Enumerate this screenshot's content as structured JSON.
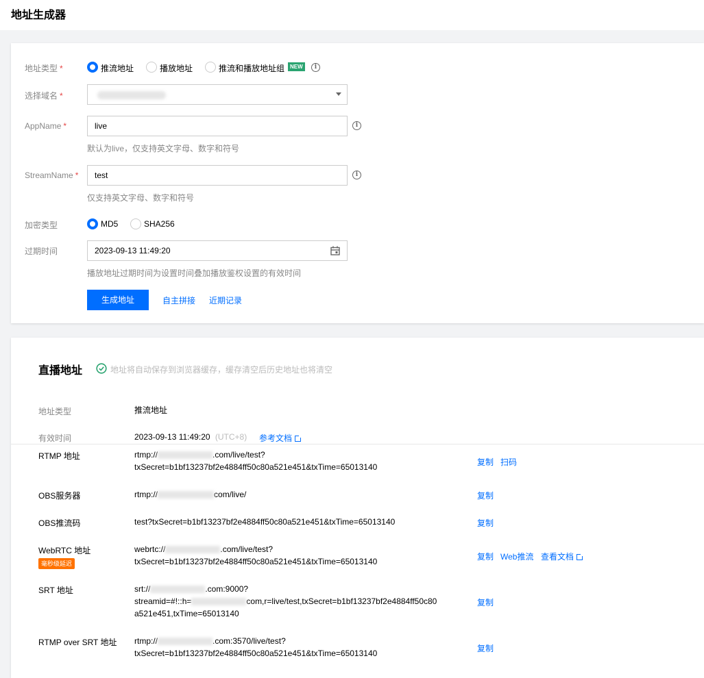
{
  "page_title": "地址生成器",
  "form": {
    "address_type": {
      "label": "地址类型",
      "required": "*",
      "options": [
        {
          "label": "推流地址",
          "selected": true
        },
        {
          "label": "播放地址",
          "selected": false
        },
        {
          "label": "推流和播放地址组",
          "selected": false
        }
      ],
      "new_badge": "NEW"
    },
    "domain": {
      "label": "选择域名",
      "required": "*"
    },
    "app_name": {
      "label": "AppName",
      "required": "*",
      "value": "live",
      "hint": "默认为live，仅支持英文字母、数字和符号"
    },
    "stream_name": {
      "label": "StreamName",
      "required": "*",
      "value": "test",
      "hint": "仅支持英文字母、数字和符号"
    },
    "encrypt_type": {
      "label": "加密类型",
      "options": [
        {
          "label": "MD5",
          "selected": true
        },
        {
          "label": "SHA256",
          "selected": false
        }
      ]
    },
    "expire_time": {
      "label": "过期时间",
      "value": "2023-09-13 11:49:20",
      "hint": "播放地址过期时间为设置时间叠加播放鉴权设置的有效时间"
    },
    "generate_button": "生成地址",
    "custom_link": "自主拼接",
    "recent_link": "近期记录"
  },
  "result": {
    "title": "直播地址",
    "notice": "地址将自动保存到浏览器缓存，缓存清空后历史地址也将清空",
    "type_label": "地址类型",
    "type_value": "推流地址",
    "valid_label": "有效时间",
    "valid_value": "2023-09-13 11:49:20",
    "valid_tz": "(UTC+8)",
    "doc_link": "参考文档",
    "rows": [
      {
        "label": "RTMP 地址",
        "line1_pre": "rtmp://",
        "line1_post": ".com/live/test?",
        "line2": "txSecret=b1bf13237bf2e4884ff50c80a521e451&txTime=65013140",
        "copy": "复制",
        "extra": "扫码"
      },
      {
        "label": "OBS服务器",
        "line1_pre": "rtmp://",
        "line1_post": "com/live/",
        "copy": "复制"
      },
      {
        "label": "OBS推流码",
        "line1": "test?txSecret=b1bf13237bf2e4884ff50c80a521e451&txTime=65013140",
        "copy": "复制"
      },
      {
        "label": "WebRTC 地址",
        "badge": "毫秒级延迟",
        "line1_pre": "webrtc://",
        "line1_post": ".com/live/test?",
        "line2": "txSecret=b1bf13237bf2e4884ff50c80a521e451&txTime=65013140",
        "copy": "复制",
        "extra": "Web推流",
        "doc": "查看文档"
      },
      {
        "label": "SRT 地址",
        "line1_pre": "srt://",
        "line1_post": ".com:9000?",
        "line2_pre": "streamid=#!::h=",
        "line2_post": "com,r=live/test,txSecret=b1bf13237bf2e4884ff50c80",
        "line3": "a521e451,txTime=65013140",
        "copy": "复制"
      },
      {
        "label": "RTMP over SRT 地址",
        "line1_pre": "rtmp://",
        "line1_post": ".com:3570/live/test?",
        "line2": "txSecret=b1bf13237bf2e4884ff50c80a521e451&txTime=65013140",
        "copy": "复制"
      }
    ]
  },
  "colors": {
    "primary": "#006eff",
    "required": "#e54545",
    "new_badge": "#2ba471",
    "latency_badge": "#ff7200",
    "success": "#2ba471"
  }
}
